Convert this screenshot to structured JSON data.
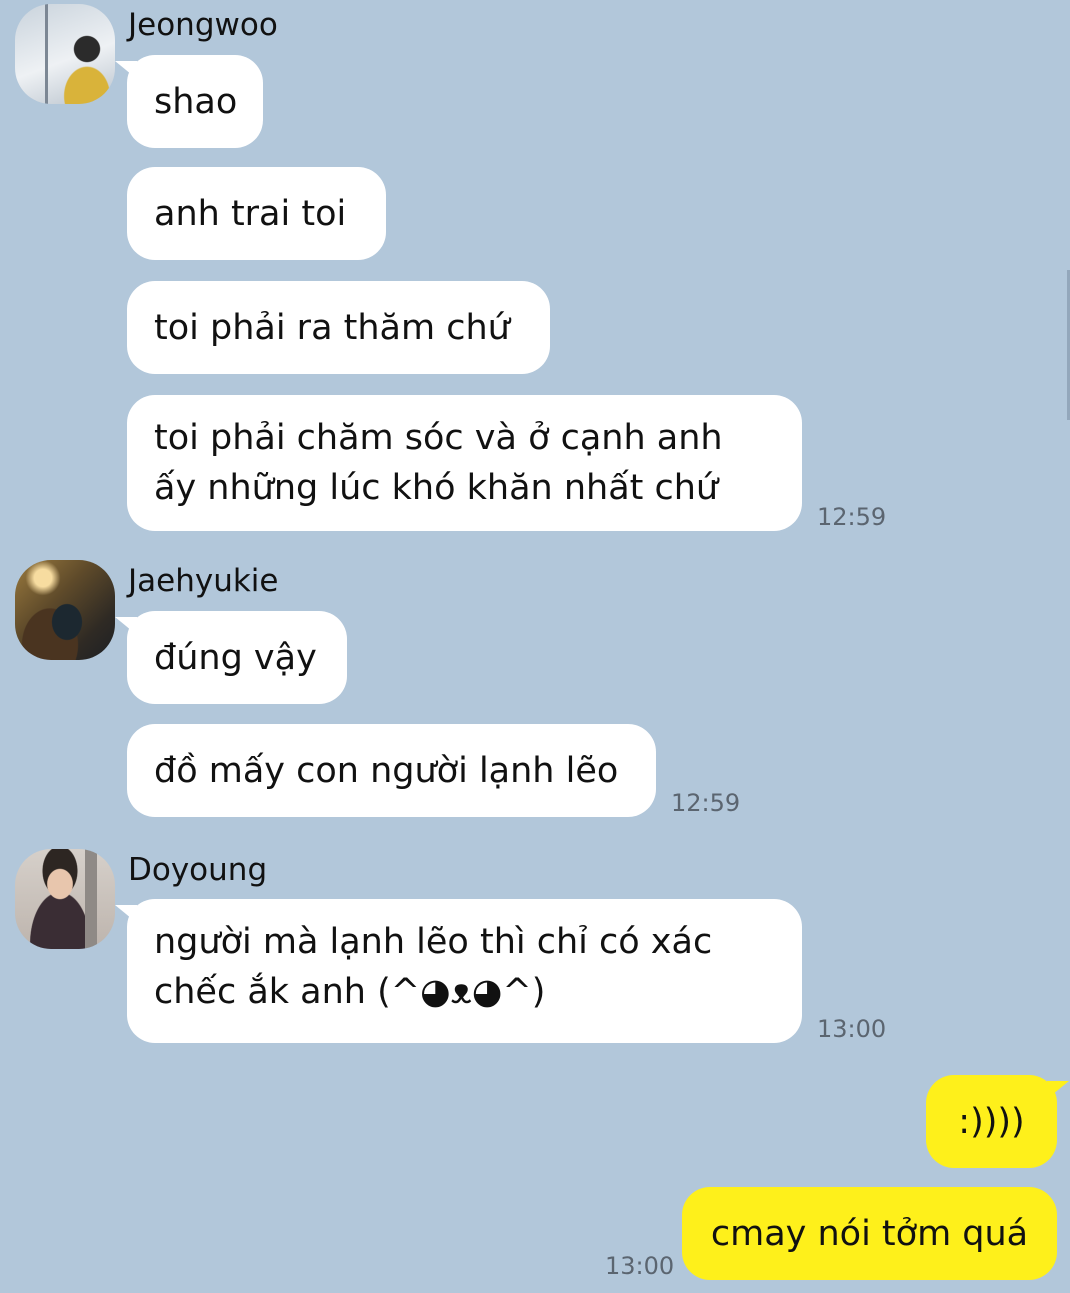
{
  "messages": [
    {
      "sender": "Jeongwoo",
      "bubbles": [
        "shao",
        "anh trai toi",
        "toi phải ra thăm chứ",
        "toi phải chăm sóc và ở cạnh anh\nấy những lúc khó khăn nhất chứ"
      ],
      "time": "12:59"
    },
    {
      "sender": "Jaehyukie",
      "bubbles": [
        "đúng vậy",
        "đồ mấy con người lạnh lẽo"
      ],
      "time": "12:59"
    },
    {
      "sender": "Doyoung",
      "bubbles": [
        "người mà lạnh lẽo thì chỉ có xác\nchếc ắk anh (^◕ᴥ◕^)"
      ],
      "time": "13:00"
    },
    {
      "sender": "me",
      "bubbles": [
        ":))))",
        "cmay nói tởm quá"
      ],
      "time": "13:00"
    }
  ],
  "colors": {
    "background": "#b2c7da",
    "incoming_bubble": "#ffffff",
    "outgoing_bubble": "#fef01b"
  }
}
